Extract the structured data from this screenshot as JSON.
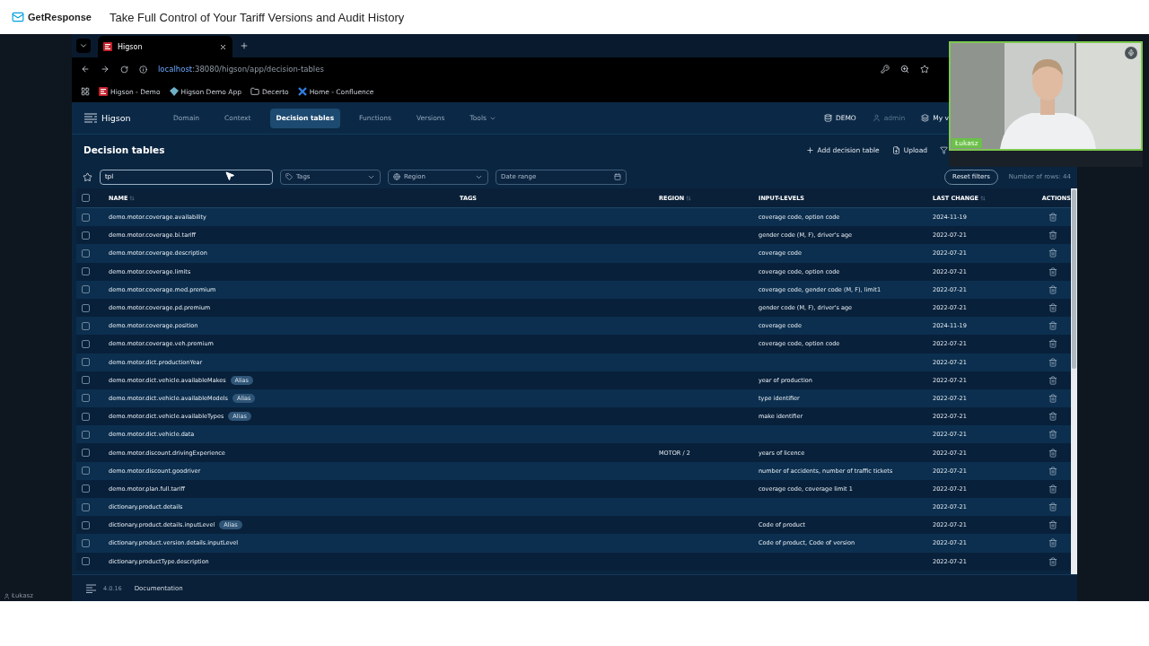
{
  "header": {
    "brand": "GetResponse",
    "title": "Take Full Control of Your Tariff Versions and Audit History"
  },
  "browser": {
    "tab": {
      "title": "Higson"
    },
    "url": {
      "host": "localhost",
      "path": ":38080/higson/app/decision-tables"
    },
    "bookmarks": [
      {
        "label": "Higson - Demo",
        "kind": "app"
      },
      {
        "label": "Higson Demo App",
        "kind": "gem"
      },
      {
        "label": "Decerto",
        "kind": "folder"
      },
      {
        "label": "Home - Confluence",
        "kind": "confluence"
      }
    ]
  },
  "app": {
    "brand": "Higson",
    "nav": [
      {
        "label": "Domain",
        "selected": false,
        "dropdown": false
      },
      {
        "label": "Context",
        "selected": false,
        "dropdown": false
      },
      {
        "label": "Decision tables",
        "selected": true,
        "dropdown": false
      },
      {
        "label": "Functions",
        "selected": false,
        "dropdown": false
      },
      {
        "label": "Versions",
        "selected": false,
        "dropdown": false
      },
      {
        "label": "Tools",
        "selected": false,
        "dropdown": true
      }
    ],
    "user_menu": [
      {
        "label": "DEMO",
        "kind": "database",
        "disabled": false
      },
      {
        "label": "admin",
        "kind": "user",
        "disabled": true
      },
      {
        "label": "My v",
        "kind": "layers",
        "disabled": false
      }
    ],
    "page_title": "Decision tables",
    "actions": [
      {
        "label": "Add decision table",
        "kind": "add"
      },
      {
        "label": "Upload",
        "kind": "upload"
      }
    ],
    "filters": {
      "search": {
        "value": "tpl"
      },
      "tags": {
        "placeholder": "Tags"
      },
      "region": {
        "placeholder": "Region"
      },
      "date": {
        "placeholder": "Date range"
      },
      "reset": "Reset filters",
      "row_count": "Number of rows: 44"
    },
    "table": {
      "select_all": {
        "checked": false
      },
      "columns": [
        {
          "label": "NAME",
          "sortable": true
        },
        {
          "label": "TAGS",
          "sortable": false
        },
        {
          "label": "REGION",
          "sortable": true
        },
        {
          "label": "INPUT-LEVELS",
          "sortable": false
        },
        {
          "label": "LAST CHANGE",
          "sortable": true
        },
        {
          "label": "ACTIONS",
          "sortable": false
        }
      ],
      "rows": [
        {
          "name": "demo.motor.coverage.availability",
          "region": "",
          "input_levels": "coverage code, option code",
          "last_change": "2024-11-19",
          "checked": false
        },
        {
          "name": "demo.motor.coverage.bi.tariff",
          "region": "",
          "input_levels": "gender code (M, F), driver's age",
          "last_change": "2022-07-21",
          "checked": false
        },
        {
          "name": "demo.motor.coverage.description",
          "region": "",
          "input_levels": "coverage code",
          "last_change": "2022-07-21",
          "checked": false
        },
        {
          "name": "demo.motor.coverage.limits",
          "region": "",
          "input_levels": "coverage code, option code",
          "last_change": "2022-07-21",
          "checked": false
        },
        {
          "name": "demo.motor.coverage.med.premium",
          "region": "",
          "input_levels": "coverage code, gender code (M, F), limit1",
          "last_change": "2022-07-21",
          "checked": false
        },
        {
          "name": "demo.motor.coverage.pd.premium",
          "region": "",
          "input_levels": "gender code (M, F), driver's age",
          "last_change": "2022-07-21",
          "checked": false
        },
        {
          "name": "demo.motor.coverage.position",
          "region": "",
          "input_levels": "coverage code",
          "last_change": "2024-11-19",
          "checked": false
        },
        {
          "name": "demo.motor.coverage.veh.premium",
          "region": "",
          "input_levels": "coverage code, option code",
          "last_change": "2022-07-21",
          "checked": false
        },
        {
          "name": "demo.motor.dict.productionYear",
          "region": "",
          "input_levels": "",
          "last_change": "2022-07-21",
          "checked": false
        },
        {
          "name": "demo.motor.dict.vehicle.availableMakes",
          "alias": "Alias",
          "region": "",
          "input_levels": "year of production",
          "last_change": "2022-07-21",
          "checked": false
        },
        {
          "name": "demo.motor.dict.vehicle.availableModels",
          "alias": "Alias",
          "region": "",
          "input_levels": "type identifier",
          "last_change": "2022-07-21",
          "checked": false
        },
        {
          "name": "demo.motor.dict.vehicle.availableTypes",
          "alias": "Alias",
          "region": "",
          "input_levels": "make identifier",
          "last_change": "2022-07-21",
          "checked": false
        },
        {
          "name": "demo.motor.dict.vehicle.data",
          "region": "",
          "input_levels": "",
          "last_change": "2022-07-21",
          "checked": false
        },
        {
          "name": "demo.motor.discount.drivingExperience",
          "region": "MOTOR / 2",
          "input_levels": "years of licence",
          "last_change": "2022-07-21",
          "checked": false
        },
        {
          "name": "demo.motor.discount.goodriver",
          "region": "",
          "input_levels": "number of accidents, number of traffic tickets",
          "last_change": "2022-07-21",
          "checked": false
        },
        {
          "name": "demo.motor.plan.full.tariff",
          "region": "",
          "input_levels": "coverage code, coverage limit 1",
          "last_change": "2022-07-21",
          "checked": false
        },
        {
          "name": "dictionary.product.details",
          "region": "",
          "input_levels": "",
          "last_change": "2022-07-21",
          "checked": false
        },
        {
          "name": "dictionary.product.details.inputLevel",
          "alias": "Alias",
          "region": "",
          "input_levels": "Code of product",
          "last_change": "2022-07-21",
          "checked": false
        },
        {
          "name": "dictionary.product.version.details.inputLevel",
          "region": "",
          "input_levels": "Code of product, Code of version",
          "last_change": "2022-07-21",
          "checked": false
        },
        {
          "name": "dictionary.productType.description",
          "region": "",
          "input_levels": "",
          "last_change": "2022-07-21",
          "checked": false
        }
      ]
    },
    "footer": {
      "version": "4.0.16",
      "link": "Documentation"
    }
  },
  "webcam": {
    "kind": "picture",
    "name": "Łukasz"
  },
  "presenter": "Łukasz"
}
